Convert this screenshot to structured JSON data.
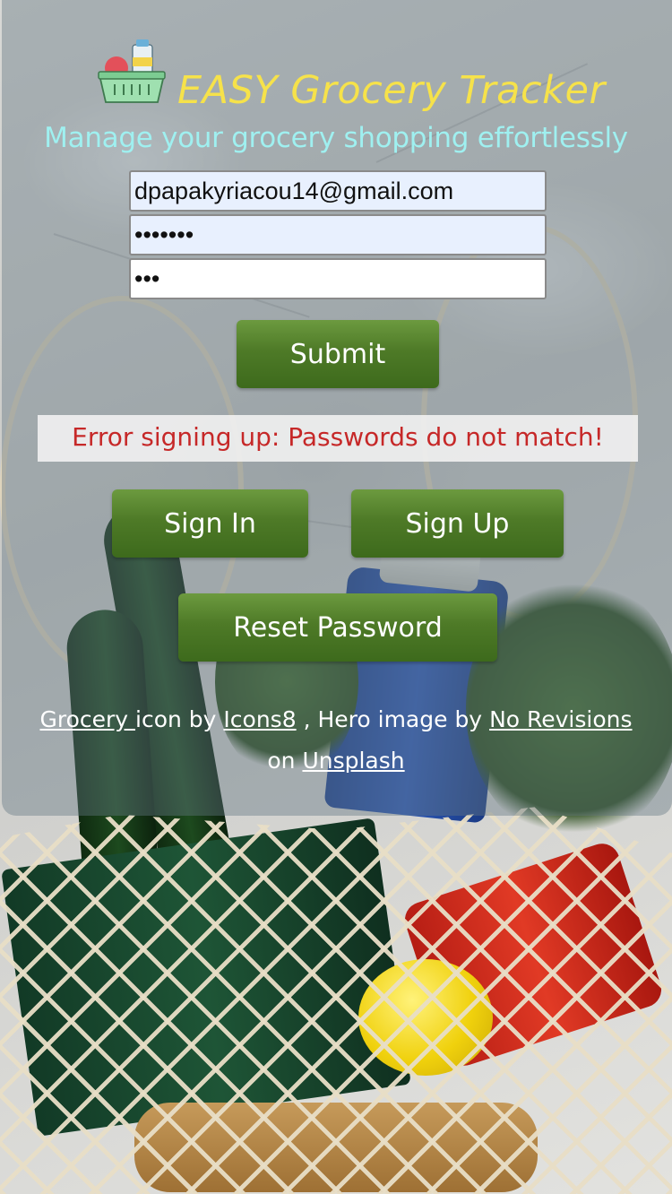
{
  "header": {
    "title": "EASY Grocery Tracker",
    "subtitle": "Manage your grocery shopping effortlessly",
    "logo_icon": "grocery-basket-icon"
  },
  "form": {
    "email_value": "dpapakyriacou14@gmail.com",
    "password_value": "1234567",
    "confirm_password_value": "123",
    "submit_label": "Submit"
  },
  "error": {
    "message": "Error signing up: Passwords do not match!"
  },
  "actions": {
    "sign_in_label": "Sign In",
    "sign_up_label": "Sign Up",
    "reset_password_label": "Reset Password"
  },
  "credits": {
    "grocery_link": "Grocery ",
    "icon_by": "icon by",
    "icons8_link": "Icons8",
    "hero_by": ", Hero image by",
    "no_revisions_link": "No Revisions",
    "on": "on",
    "unsplash_link": "Unsplash"
  },
  "colors": {
    "title": "#f6e24a",
    "subtitle": "#9ff0f0",
    "button": "#4e7a27",
    "error_text": "#c62828"
  }
}
